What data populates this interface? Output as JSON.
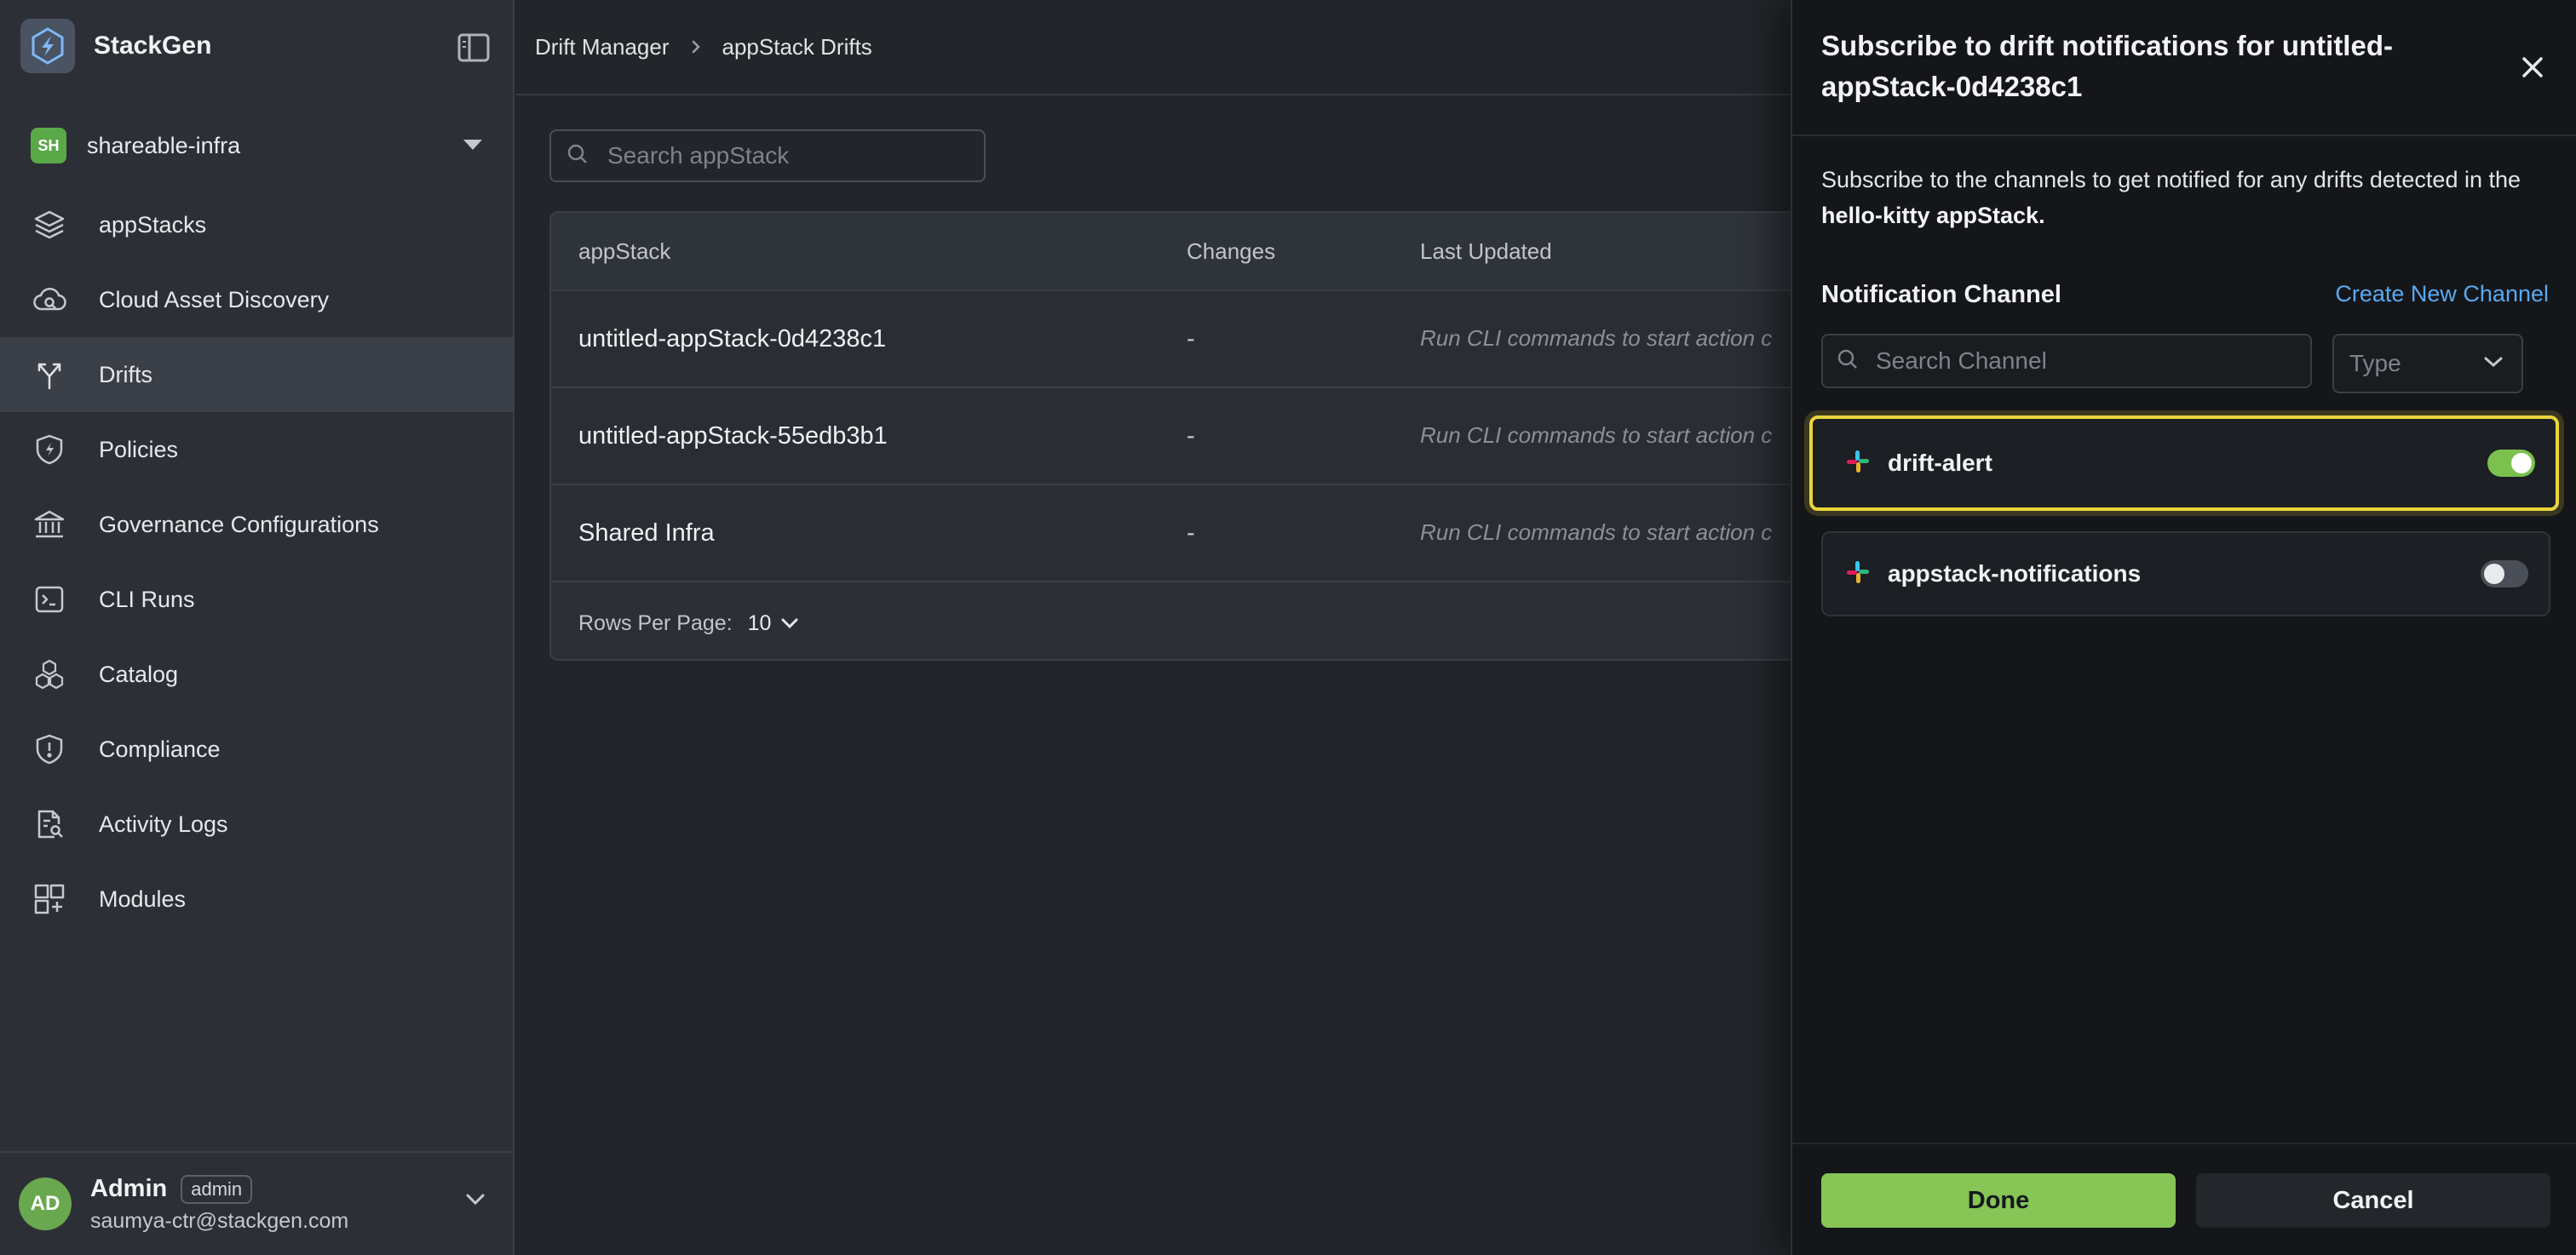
{
  "brand": {
    "name": "StackGen"
  },
  "workspace": {
    "badge": "SH",
    "name": "shareable-infra"
  },
  "nav": [
    {
      "label": "appStacks",
      "icon": "layers-icon"
    },
    {
      "label": "Cloud Asset Discovery",
      "icon": "cloud-search-icon"
    },
    {
      "label": "Drifts",
      "icon": "drift-arrows-icon",
      "active": true
    },
    {
      "label": "Policies",
      "icon": "shield-bolt-icon"
    },
    {
      "label": "Governance Configurations",
      "icon": "bank-icon"
    },
    {
      "label": "CLI Runs",
      "icon": "terminal-icon"
    },
    {
      "label": "Catalog",
      "icon": "cubes-icon"
    },
    {
      "label": "Compliance",
      "icon": "shield-alert-icon"
    },
    {
      "label": "Activity Logs",
      "icon": "document-search-icon"
    },
    {
      "label": "Modules",
      "icon": "grid-plus-icon"
    }
  ],
  "user": {
    "initials": "AD",
    "name": "Admin",
    "role": "admin",
    "email": "saumya-ctr@stackgen.com"
  },
  "breadcrumb": {
    "parent": "Drift Manager",
    "current": "appStack Drifts"
  },
  "search": {
    "placeholder": "Search appStack"
  },
  "table": {
    "headers": {
      "appstack": "appStack",
      "changes": "Changes",
      "last_updated": "Last Updated"
    },
    "rows": [
      {
        "name": "untitled-appStack-0d4238c1",
        "changes": "-",
        "last_updated": "Run CLI commands to start action c"
      },
      {
        "name": "untitled-appStack-55edb3b1",
        "changes": "-",
        "last_updated": "Run CLI commands to start action c"
      },
      {
        "name": "Shared Infra",
        "changes": "-",
        "last_updated": "Run CLI commands to start action c"
      }
    ],
    "footer": {
      "rows_per_page_label": "Rows Per Page:",
      "rows_per_page_value": "10"
    }
  },
  "drawer": {
    "title": "Subscribe to drift notifications for untitled-appStack-0d4238c1",
    "desc_prefix": "Subscribe to the channels to get notified for any drifts detected in the",
    "desc_bold": "hello-kitty appStack.",
    "channel_label": "Notification Channel",
    "create_link": "Create New Channel",
    "search_placeholder": "Search Channel",
    "type_placeholder": "Type",
    "channels": [
      {
        "name": "drift-alert",
        "enabled": true
      },
      {
        "name": "appstack-notifications",
        "enabled": false
      }
    ],
    "done_label": "Done",
    "cancel_label": "Cancel"
  },
  "colors": {
    "accent_green": "#86c556",
    "link_blue": "#5aa9f0",
    "highlight_yellow": "#e9d53b"
  }
}
